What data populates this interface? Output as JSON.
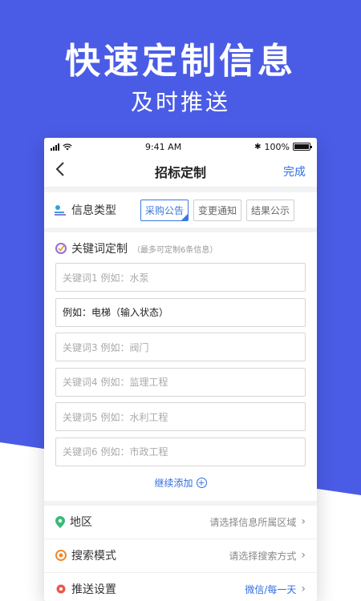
{
  "promo": {
    "headline": "快速定制信息",
    "subhead": "及时推送"
  },
  "status_bar": {
    "time": "9:41 AM",
    "battery": "100%"
  },
  "nav": {
    "back_icon": "chevron-left-icon",
    "title": "招标定制",
    "done_label": "完成"
  },
  "info_type": {
    "label": "信息类型",
    "options": [
      {
        "label": "采购公告",
        "active": true
      },
      {
        "label": "变更通知",
        "active": false
      },
      {
        "label": "结果公示",
        "active": false
      }
    ]
  },
  "keywords": {
    "title": "关键词定制",
    "note": "（最多可定制6条信息）",
    "fields": [
      {
        "text": "关键词1  例如：水泵",
        "filled": false
      },
      {
        "text": "例如：电梯（输入状态）",
        "filled": true
      },
      {
        "text": "关键词3  例如：阀门",
        "filled": false
      },
      {
        "text": "关键词4  例如：监理工程",
        "filled": false
      },
      {
        "text": "关键词5  例如：水利工程",
        "filled": false
      },
      {
        "text": "关键词6  例如：市政工程",
        "filled": false
      }
    ],
    "add_more": "继续添加"
  },
  "settings": [
    {
      "label": "地区",
      "value": "请选择信息所属区域",
      "icon": "location-pin-icon",
      "accent": false
    },
    {
      "label": "搜索模式",
      "value": "请选择搜索方式",
      "icon": "target-icon",
      "accent": false
    },
    {
      "label": "推送设置",
      "value": "微信/每一天",
      "icon": "gear-icon",
      "accent": true
    }
  ],
  "colors": {
    "brand_blue": "#4a5ce6",
    "accent": "#2f6de0"
  }
}
